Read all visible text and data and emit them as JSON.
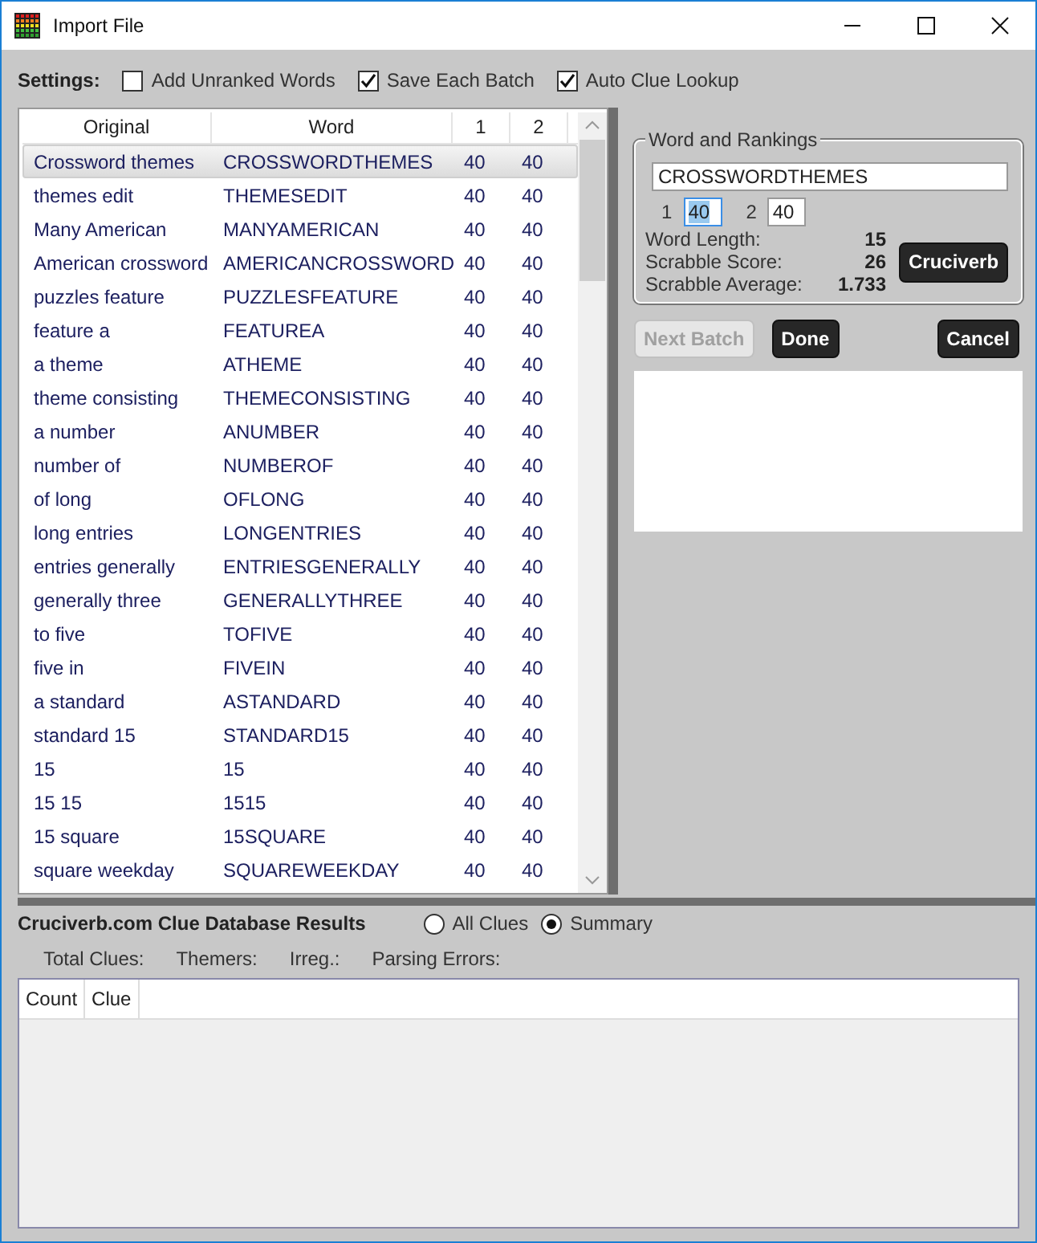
{
  "window": {
    "title": "Import File"
  },
  "settings": {
    "label": "Settings:",
    "options": [
      {
        "label": "Add Unranked Words",
        "checked": false
      },
      {
        "label": "Save Each Batch",
        "checked": true
      },
      {
        "label": "Auto Clue Lookup",
        "checked": true
      }
    ]
  },
  "table": {
    "columns": [
      "Original",
      "Word",
      "1",
      "2"
    ],
    "rows": [
      {
        "original": "Crossword themes",
        "word": "CROSSWORDTHEMES",
        "rank_1": "40",
        "rank_2": "40",
        "selected": true
      },
      {
        "original": "themes edit",
        "word": "THEMESEDIT",
        "rank_1": "40",
        "rank_2": "40",
        "selected": false
      },
      {
        "original": "Many American",
        "word": "MANYAMERICAN",
        "rank_1": "40",
        "rank_2": "40",
        "selected": false
      },
      {
        "original": "American crossword",
        "word": "AMERICANCROSSWORD",
        "rank_1": "40",
        "rank_2": "40",
        "selected": false
      },
      {
        "original": "puzzles feature",
        "word": "PUZZLESFEATURE",
        "rank_1": "40",
        "rank_2": "40",
        "selected": false
      },
      {
        "original": "feature a",
        "word": "FEATUREA",
        "rank_1": "40",
        "rank_2": "40",
        "selected": false
      },
      {
        "original": "a theme",
        "word": "ATHEME",
        "rank_1": "40",
        "rank_2": "40",
        "selected": false
      },
      {
        "original": "theme consisting",
        "word": "THEMECONSISTING",
        "rank_1": "40",
        "rank_2": "40",
        "selected": false
      },
      {
        "original": "a number",
        "word": "ANUMBER",
        "rank_1": "40",
        "rank_2": "40",
        "selected": false
      },
      {
        "original": "number of",
        "word": "NUMBEROF",
        "rank_1": "40",
        "rank_2": "40",
        "selected": false
      },
      {
        "original": "of long",
        "word": "OFLONG",
        "rank_1": "40",
        "rank_2": "40",
        "selected": false
      },
      {
        "original": "long entries",
        "word": "LONGENTRIES",
        "rank_1": "40",
        "rank_2": "40",
        "selected": false
      },
      {
        "original": "entries generally",
        "word": "ENTRIESGENERALLY",
        "rank_1": "40",
        "rank_2": "40",
        "selected": false
      },
      {
        "original": "generally three",
        "word": "GENERALLYTHREE",
        "rank_1": "40",
        "rank_2": "40",
        "selected": false
      },
      {
        "original": "to five",
        "word": "TOFIVE",
        "rank_1": "40",
        "rank_2": "40",
        "selected": false
      },
      {
        "original": "five in",
        "word": "FIVEIN",
        "rank_1": "40",
        "rank_2": "40",
        "selected": false
      },
      {
        "original": "a standard",
        "word": "ASTANDARD",
        "rank_1": "40",
        "rank_2": "40",
        "selected": false
      },
      {
        "original": "standard 15",
        "word": "STANDARD15",
        "rank_1": "40",
        "rank_2": "40",
        "selected": false
      },
      {
        "original": "15",
        "word": "15",
        "rank_1": "40",
        "rank_2": "40",
        "selected": false
      },
      {
        "original": "15 15",
        "word": "1515",
        "rank_1": "40",
        "rank_2": "40",
        "selected": false
      },
      {
        "original": "15 square",
        "word": "15SQUARE",
        "rank_1": "40",
        "rank_2": "40",
        "selected": false
      },
      {
        "original": "square weekday",
        "word": "SQUAREWEEKDAY",
        "rank_1": "40",
        "rank_2": "40",
        "selected": false
      }
    ]
  },
  "word_panel": {
    "legend": "Word and Rankings",
    "word": "CROSSWORDTHEMES",
    "rankings": [
      {
        "label": "1",
        "value": "40",
        "selected": true
      },
      {
        "label": "2",
        "value": "40",
        "selected": false
      }
    ],
    "stats": [
      {
        "label": "Word Length:",
        "value": "15"
      },
      {
        "label": "Scrabble Score:",
        "value": "26"
      },
      {
        "label": "Scrabble Average:",
        "value": "1.733"
      }
    ],
    "lookup_button": "Cruciverb"
  },
  "buttons": [
    {
      "label": "Next Batch",
      "disabled": true
    },
    {
      "label": "Done",
      "disabled": false
    },
    {
      "label": "Cancel",
      "disabled": false
    }
  ],
  "results": {
    "title": "Cruciverb.com Clue Database Results",
    "options": [
      {
        "label": "All Clues",
        "selected": false
      },
      {
        "label": "Summary",
        "selected": true
      }
    ],
    "stats": [
      "Total Clues:",
      "Themers:",
      "Irreg.:",
      "Parsing Errors:"
    ],
    "columns": [
      "Count",
      "Clue"
    ]
  }
}
